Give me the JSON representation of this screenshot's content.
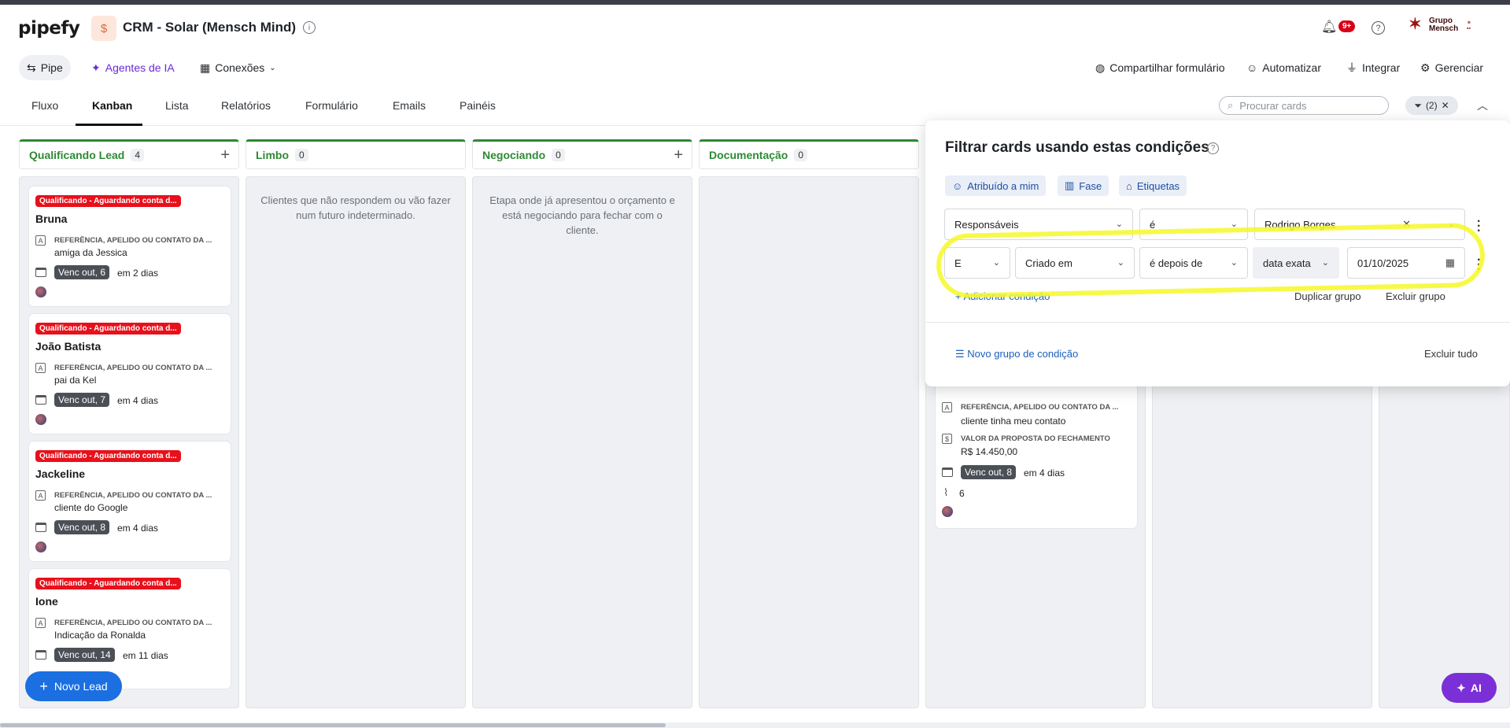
{
  "header": {
    "logo": "pipefy",
    "pipe_title": "CRM - Solar (Mensch Mind)",
    "notifications_badge": "9+",
    "company_name_line1": "Grupo",
    "company_name_line2": "Mensch"
  },
  "toolbar": {
    "pipe_label": "Pipe",
    "ai_agents_label": "Agentes de IA",
    "connections_label": "Conexões",
    "share_form_label": "Compartilhar formulário",
    "automate_label": "Automatizar",
    "integrate_label": "Integrar",
    "manage_label": "Gerenciar"
  },
  "tabs": [
    {
      "label": "Fluxo"
    },
    {
      "label": "Kanban"
    },
    {
      "label": "Lista"
    },
    {
      "label": "Relatórios"
    },
    {
      "label": "Formulário"
    },
    {
      "label": "Emails"
    },
    {
      "label": "Painéis"
    }
  ],
  "search": {
    "placeholder": "Procurar cards"
  },
  "filter_pill": {
    "count": "(2)"
  },
  "columns": [
    {
      "title": "Qualificando Lead",
      "count": "4",
      "empty_text": ""
    },
    {
      "title": "Limbo",
      "count": "0",
      "empty_text": "Clientes que não respondem ou vão fazer num futuro indeterminado."
    },
    {
      "title": "Negociando",
      "count": "0",
      "empty_text": "Etapa onde já apresentou o orçamento e está negociando para fechar com o cliente."
    },
    {
      "title": "Documentação",
      "count": "0",
      "empty_text": ""
    }
  ],
  "cards": [
    {
      "label": "Qualificando - Aguardando conta d...",
      "name": "Bruna",
      "field_label": "REFERÊNCIA, APELIDO OU CONTATO DA ...",
      "field_value": "amiga da Jessica",
      "due": "Venc out, 6",
      "due_in": "em 2 dias"
    },
    {
      "label": "Qualificando - Aguardando conta d...",
      "name": "João Batista",
      "field_label": "REFERÊNCIA, APELIDO OU CONTATO DA ...",
      "field_value": "pai da Kel",
      "due": "Venc out, 7",
      "due_in": "em 4 dias"
    },
    {
      "label": "Qualificando - Aguardando conta d...",
      "name": "Jackeline",
      "field_label": "REFERÊNCIA, APELIDO OU CONTATO DA ...",
      "field_value": "cliente do Google",
      "due": "Venc out, 8",
      "due_in": "em 4 dias"
    },
    {
      "label": "Qualificando - Aguardando conta d...",
      "name": "Ione",
      "field_label": "REFERÊNCIA, APELIDO OU CONTATO DA ...",
      "field_value": "Indicação da Ronalda",
      "due": "Venc out, 14",
      "due_in": "em 11 dias"
    }
  ],
  "partial_card": {
    "field_label": "REFERÊNCIA, APELIDO OU CONTATO DA ...",
    "field_value": "cliente tinha meu contato",
    "value_label": "VALOR DA PROPOSTA DO FECHAMENTO",
    "value": "R$ 14.450,00",
    "due": "Venc out, 8",
    "due_in": "em 4 dias",
    "attachments": "6"
  },
  "fab": {
    "label": "Novo Lead"
  },
  "ai_button": {
    "label": "AI"
  },
  "filter_panel": {
    "title": "Filtrar cards usando estas condições",
    "chips": [
      "Atribuído a mim",
      "Fase",
      "Etiquetas"
    ],
    "row1": {
      "field": "Responsáveis",
      "operator": "é",
      "value": "Rodrigo Borges"
    },
    "row2": {
      "connector": "E",
      "field": "Criado em",
      "operator": "é depois de",
      "mode": "data exata",
      "date": "01/10/2025"
    },
    "add_condition": "Adicionar condição",
    "duplicate_group": "Duplicar grupo",
    "delete_group": "Excluir grupo",
    "new_group": "Novo grupo de condição",
    "delete_all": "Excluir tudo"
  },
  "colors": {
    "accent": "#1b6fe0",
    "stage_green": "#2d8a34",
    "label_red": "#e8101b",
    "ai_purple": "#7b2fd6"
  }
}
